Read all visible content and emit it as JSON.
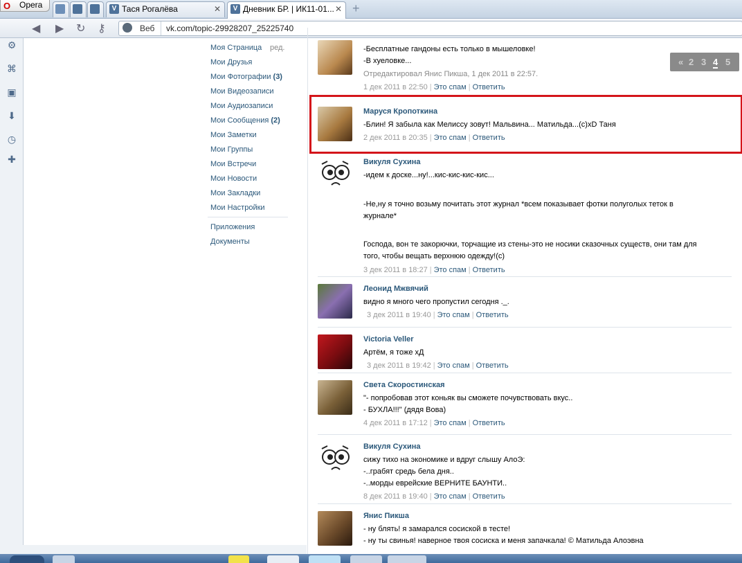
{
  "browser": {
    "app_label": "Opera",
    "tabs": [
      {
        "label": "",
        "favicon": "tab-icon"
      },
      {
        "label": "",
        "favicon": "tab-icon"
      },
      {
        "label": "Тася Рогалёва",
        "favicon": "V"
      },
      {
        "label": "Дневник БР. | ИК11-01...",
        "favicon": "V"
      }
    ],
    "address": {
      "web_label": "Веб",
      "url": "vk.com/topic-29928207_25225740"
    }
  },
  "menu": {
    "edit_label": "ред.",
    "items": [
      {
        "label": "Моя Страница",
        "count": ""
      },
      {
        "label": "Мои Друзья",
        "count": ""
      },
      {
        "label": "Мои Фотографии",
        "count": "(3)"
      },
      {
        "label": "Мои Видеозаписи",
        "count": ""
      },
      {
        "label": "Мои Аудиозаписи",
        "count": ""
      },
      {
        "label": "Мои Сообщения",
        "count": "(2)"
      },
      {
        "label": "Мои Заметки",
        "count": ""
      },
      {
        "label": "Мои Группы",
        "count": ""
      },
      {
        "label": "Мои Встречи",
        "count": ""
      },
      {
        "label": "Мои Новости",
        "count": ""
      },
      {
        "label": "Мои Закладки",
        "count": ""
      },
      {
        "label": "Мои Настройки",
        "count": ""
      }
    ],
    "extra": [
      {
        "label": "Приложения"
      },
      {
        "label": "Документы"
      }
    ]
  },
  "pager": {
    "prev": "«",
    "pages": [
      "2",
      "3",
      "4",
      "5"
    ],
    "current": "4"
  },
  "actions": {
    "spam": "Это спам",
    "reply": "Ответить"
  },
  "posts": [
    {
      "author": "",
      "lines": [
        "-Бесплатные гандоны есть только в мышеловке!",
        "-В хуеловке..."
      ],
      "edited": "Отредактировал Янис Пикша, 1 дек 2011 в 22:57.",
      "date": "1 дек 2011 в 22:50"
    },
    {
      "author": "Маруся Кропоткина",
      "lines": [
        "-Блин! Я забыла как Мелиссу зовут! Мальвина... Матильда...(с)xD Таня"
      ],
      "date": "2 дек 2011 в 20:35"
    },
    {
      "author": "Викуля Сухина",
      "lines": [
        "-идем к доске...ну!...кис-кис-кис-кис...",
        "",
        "-Не,ну я точно возьму почитать этот журнал *всем показывает фотки полуголых теток в",
        "журнале*",
        "",
        "Господа, вон те закорючки, торчащие из стены-это не носики сказочных существ, они там для",
        "того, чтобы вещать верхнюю одежду!(с)"
      ],
      "date": "3 дек 2011 в 18:27"
    },
    {
      "author": "Леонид Мжвячий",
      "lines": [
        "видно я много чего пропустил сегодня ._."
      ],
      "date": "3 дек 2011 в 19:40"
    },
    {
      "author": "Victoria Veller",
      "lines": [
        "Артём, я тоже хД"
      ],
      "date": "3 дек 2011 в 19:42"
    },
    {
      "author": "Света Скоростинская",
      "lines": [
        "\"- попробовав этот коньяк вы сможете почувствовать вкус..",
        "- БУХЛА!!!\" (дядя Вова)"
      ],
      "date": "4 дек 2011 в 17:12"
    },
    {
      "author": "Викуля Сухина",
      "lines": [
        "сижу тихо на экономике и вдруг слышу АлоЭ:",
        "-..грабят средь бела дня..",
        "-..морды еврейские ВЕРНИТЕ БАУНТИ.."
      ],
      "date": "8 дек 2011 в 19:40"
    },
    {
      "author": "Янис Пикша",
      "lines": [
        "- ну блять! я замарался сосиской в тесте!",
        "- ну ты свинья! наверное твоя сосиска и меня запачкала! © Матильда Алоэвна"
      ],
      "date": ""
    }
  ]
}
